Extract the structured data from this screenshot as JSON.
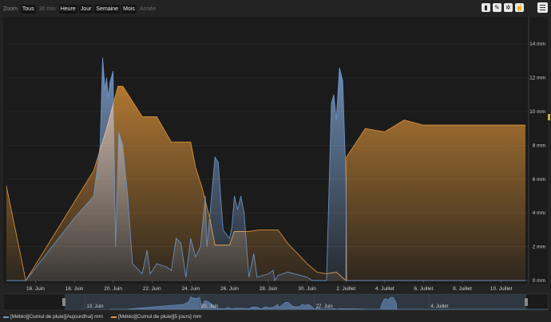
{
  "toolbar": {
    "zoom_label": "Zoom",
    "buttons": [
      {
        "label": "Tous",
        "state": "on"
      },
      {
        "label": "30 min",
        "state": "off"
      },
      {
        "label": "Heure",
        "state": "on"
      },
      {
        "label": "Jour",
        "state": "on"
      },
      {
        "label": "Semaine",
        "state": "on"
      },
      {
        "label": "Mois",
        "state": "on"
      },
      {
        "label": "Année",
        "state": "off"
      }
    ],
    "tools": [
      "bar-chart-icon",
      "pencil-icon",
      "crosshair-icon",
      "pointer-hand-icon"
    ],
    "menu_icon": "hamburger-menu-icon"
  },
  "colors": {
    "background": "#232323",
    "grid": "#3a3a3a",
    "series_blue": "#6e97cc",
    "series_orange": "#e1963a",
    "overlap": "#b9b0a5",
    "navigator_band": "#4a5a72"
  },
  "chart_data": {
    "type": "area",
    "title": "",
    "xlabel": "",
    "ylabel": "",
    "x_ticks": [
      "16. Juin",
      "18. Juin",
      "20. Juin",
      "22. Juin",
      "24. Juin",
      "26. Juin",
      "28. Juin",
      "30. Juin",
      "2. Juillet",
      "4. Juillet",
      "6. Juillet",
      "8. Juillet",
      "10. Juillet"
    ],
    "y_ticks": [
      "0 mm",
      "2 mm",
      "4 mm",
      "6 mm",
      "8 mm",
      "10 mm",
      "12 mm",
      "14 mm"
    ],
    "ylim": [
      0,
      15
    ],
    "xlim": [
      "2020-06-14T12:00",
      "2020-07-11T06:00"
    ],
    "grid": true,
    "legend_position": "bottom-left",
    "series": [
      {
        "name": "[Météo][Cumul de pluie][Aujourdhui] mm",
        "color": "#6e97cc",
        "points": [
          [
            "2020-06-14T12:00",
            0.0
          ],
          [
            "2020-06-15T12:00",
            0.0
          ],
          [
            "2020-06-18T00:00",
            3.7
          ],
          [
            "2020-06-19T00:00",
            5.0
          ],
          [
            "2020-06-19T08:00",
            8.0
          ],
          [
            "2020-06-19T11:00",
            13.2
          ],
          [
            "2020-06-19T14:00",
            11.3
          ],
          [
            "2020-06-19T16:00",
            12.0
          ],
          [
            "2020-06-19T18:00",
            10.8
          ],
          [
            "2020-06-19T20:00",
            11.7
          ],
          [
            "2020-06-20T00:00",
            12.4
          ],
          [
            "2020-06-20T03:00",
            2.0
          ],
          [
            "2020-06-20T07:00",
            8.8
          ],
          [
            "2020-06-20T12:00",
            8.0
          ],
          [
            "2020-06-20T18:00",
            5.0
          ],
          [
            "2020-06-21T00:00",
            1.0
          ],
          [
            "2020-06-21T12:00",
            0.4
          ],
          [
            "2020-06-21T18:00",
            1.8
          ],
          [
            "2020-06-21T22:00",
            0.4
          ],
          [
            "2020-06-22T06:00",
            1.0
          ],
          [
            "2020-06-22T18:00",
            0.8
          ],
          [
            "2020-06-23T00:00",
            0.6
          ],
          [
            "2020-06-23T06:00",
            2.5
          ],
          [
            "2020-06-23T12:00",
            2.2
          ],
          [
            "2020-06-23T18:00",
            0.2
          ],
          [
            "2020-06-24T00:00",
            2.5
          ],
          [
            "2020-06-24T06:00",
            1.4
          ],
          [
            "2020-06-24T12:00",
            2.0
          ],
          [
            "2020-06-24T18:00",
            5.0
          ],
          [
            "2020-06-24T20:00",
            2.0
          ],
          [
            "2020-06-25T00:00",
            4.0
          ],
          [
            "2020-06-25T06:00",
            7.3
          ],
          [
            "2020-06-25T10:00",
            7.0
          ],
          [
            "2020-06-25T16:00",
            3.0
          ],
          [
            "2020-06-26T00:00",
            2.5
          ],
          [
            "2020-06-26T03:00",
            3.2
          ],
          [
            "2020-06-26T06:00",
            5.0
          ],
          [
            "2020-06-26T10:00",
            4.2
          ],
          [
            "2020-06-26T14:00",
            5.0
          ],
          [
            "2020-06-26T18:00",
            4.0
          ],
          [
            "2020-06-27T00:00",
            0.2
          ],
          [
            "2020-06-27T06:00",
            1.6
          ],
          [
            "2020-06-27T10:00",
            0.2
          ],
          [
            "2020-06-28T00:00",
            0.4
          ],
          [
            "2020-06-28T06:00",
            0.6
          ],
          [
            "2020-06-28T08:00",
            0.0
          ],
          [
            "2020-06-28T12:00",
            0.3
          ],
          [
            "2020-06-29T00:00",
            0.5
          ],
          [
            "2020-06-30T00:00",
            0.2
          ],
          [
            "2020-06-30T06:00",
            0.0
          ],
          [
            "2020-07-01T00:00",
            0.0
          ],
          [
            "2020-07-01T06:00",
            10.5
          ],
          [
            "2020-07-01T09:00",
            11.0
          ],
          [
            "2020-07-01T12:00",
            9.5
          ],
          [
            "2020-07-01T16:00",
            12.6
          ],
          [
            "2020-07-01T20:00",
            11.8
          ],
          [
            "2020-07-02T00:00",
            6.0
          ],
          [
            "2020-07-02T01:00",
            0.0
          ],
          [
            "2020-07-11T06:00",
            0.0
          ]
        ]
      },
      {
        "name": "[Météo][Cumul de pluie][5 jours] mm",
        "color": "#e1963a",
        "points": [
          [
            "2020-06-14T12:00",
            5.6
          ],
          [
            "2020-06-15T12:00",
            0.0
          ],
          [
            "2020-06-19T00:00",
            6.5
          ],
          [
            "2020-06-19T16:00",
            9.0
          ],
          [
            "2020-06-20T06:00",
            11.5
          ],
          [
            "2020-06-20T12:00",
            11.5
          ],
          [
            "2020-06-21T12:00",
            9.7
          ],
          [
            "2020-06-22T06:00",
            9.7
          ],
          [
            "2020-06-23T00:00",
            8.2
          ],
          [
            "2020-06-24T00:00",
            8.2
          ],
          [
            "2020-06-24T06:00",
            6.7
          ],
          [
            "2020-06-24T14:00",
            5.5
          ],
          [
            "2020-06-25T00:00",
            3.6
          ],
          [
            "2020-06-25T06:00",
            2.1
          ],
          [
            "2020-06-26T00:00",
            2.1
          ],
          [
            "2020-06-26T06:00",
            2.9
          ],
          [
            "2020-06-27T00:00",
            2.9
          ],
          [
            "2020-06-27T12:00",
            3.0
          ],
          [
            "2020-06-28T12:00",
            3.0
          ],
          [
            "2020-06-29T00:00",
            2.2
          ],
          [
            "2020-06-29T12:00",
            1.6
          ],
          [
            "2020-06-30T00:00",
            1.0
          ],
          [
            "2020-06-30T12:00",
            0.5
          ],
          [
            "2020-07-01T00:00",
            0.4
          ],
          [
            "2020-07-01T12:00",
            0.5
          ],
          [
            "2020-07-02T00:00",
            0.0
          ],
          [
            "2020-07-02T00:30",
            7.3
          ],
          [
            "2020-07-03T00:00",
            9.0
          ],
          [
            "2020-07-04T00:00",
            8.8
          ],
          [
            "2020-07-05T00:00",
            9.5
          ],
          [
            "2020-07-06T00:00",
            9.2
          ],
          [
            "2020-07-11T06:00",
            9.2
          ]
        ]
      }
    ],
    "navigator": {
      "labels": [
        "13. Juin",
        "20. Juin",
        "27. Juin",
        "4. Juillet"
      ]
    }
  }
}
